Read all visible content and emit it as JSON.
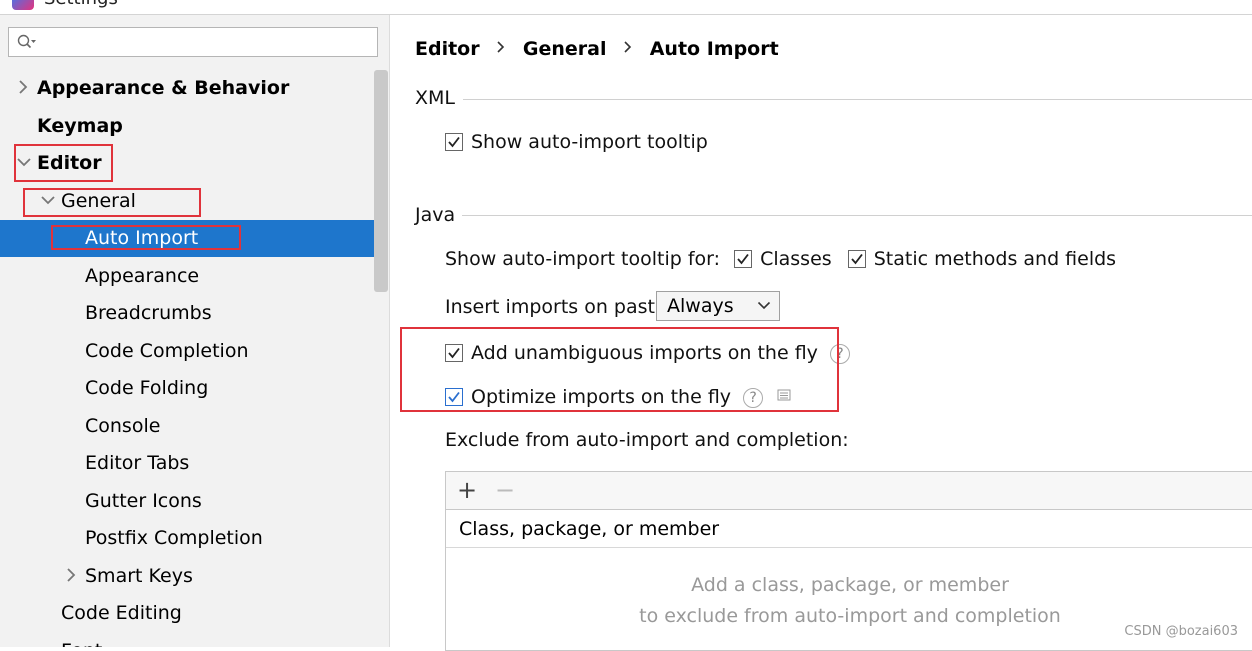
{
  "window": {
    "title": "Settings"
  },
  "search": {
    "value": "",
    "placeholder": ""
  },
  "tree": [
    {
      "label": "Appearance & Behavior",
      "bold": true,
      "arrow": "right",
      "indent": 0,
      "selected": false,
      "name": "tree-item-appearance-behavior"
    },
    {
      "label": "Keymap",
      "bold": true,
      "arrow": "none",
      "indent": 0,
      "selected": false,
      "name": "tree-item-keymap"
    },
    {
      "label": "Editor",
      "bold": true,
      "arrow": "down",
      "indent": 0,
      "selected": false,
      "name": "tree-item-editor"
    },
    {
      "label": "General",
      "bold": false,
      "arrow": "down",
      "indent": 1,
      "selected": false,
      "name": "tree-item-general"
    },
    {
      "label": "Auto Import",
      "bold": false,
      "arrow": "none",
      "indent": 2,
      "selected": true,
      "name": "tree-item-auto-import"
    },
    {
      "label": "Appearance",
      "bold": false,
      "arrow": "none",
      "indent": 2,
      "selected": false,
      "name": "tree-item-appearance"
    },
    {
      "label": "Breadcrumbs",
      "bold": false,
      "arrow": "none",
      "indent": 2,
      "selected": false,
      "name": "tree-item-breadcrumbs"
    },
    {
      "label": "Code Completion",
      "bold": false,
      "arrow": "none",
      "indent": 2,
      "selected": false,
      "name": "tree-item-code-completion"
    },
    {
      "label": "Code Folding",
      "bold": false,
      "arrow": "none",
      "indent": 2,
      "selected": false,
      "name": "tree-item-code-folding"
    },
    {
      "label": "Console",
      "bold": false,
      "arrow": "none",
      "indent": 2,
      "selected": false,
      "name": "tree-item-console"
    },
    {
      "label": "Editor Tabs",
      "bold": false,
      "arrow": "none",
      "indent": 2,
      "selected": false,
      "name": "tree-item-editor-tabs"
    },
    {
      "label": "Gutter Icons",
      "bold": false,
      "arrow": "none",
      "indent": 2,
      "selected": false,
      "name": "tree-item-gutter-icons"
    },
    {
      "label": "Postfix Completion",
      "bold": false,
      "arrow": "none",
      "indent": 2,
      "selected": false,
      "name": "tree-item-postfix-completion"
    },
    {
      "label": "Smart Keys",
      "bold": false,
      "arrow": "right",
      "indent": 2,
      "selected": false,
      "name": "tree-item-smart-keys"
    },
    {
      "label": "Code Editing",
      "bold": false,
      "arrow": "none",
      "indent": 1,
      "selected": false,
      "name": "tree-item-code-editing"
    },
    {
      "label": "Font",
      "bold": false,
      "arrow": "none",
      "indent": 1,
      "selected": false,
      "name": "tree-item-font"
    }
  ],
  "breadcrumbs": [
    "Editor",
    "General",
    "Auto Import"
  ],
  "xml": {
    "title": "XML",
    "show_tooltip": {
      "label": "Show auto-import tooltip",
      "checked": true
    }
  },
  "java": {
    "title": "Java",
    "tooltip_for_label": "Show auto-import tooltip for:",
    "classes": {
      "label": "Classes",
      "checked": true
    },
    "static_methods": {
      "label": "Static methods and fields",
      "checked": true
    },
    "insert_on_paste_label": "Insert imports on paste:",
    "insert_on_paste_value": "Always",
    "add_unambiguous": {
      "label": "Add unambiguous imports on the fly",
      "checked": true
    },
    "optimize_imports": {
      "label": "Optimize imports on the fly",
      "checked": true
    },
    "exclude_label": "Exclude from auto-import and completion:",
    "table_column": "Class, package, or member",
    "empty_line1": "Add a class, package, or member",
    "empty_line2": "to exclude from auto-import and completion"
  },
  "help_glyph": "?",
  "watermark": "CSDN @bozai603",
  "colors": {
    "selection": "#1e76cc",
    "highlight_box": "#e0333b",
    "sidebar_bg": "#f2f2f2"
  }
}
